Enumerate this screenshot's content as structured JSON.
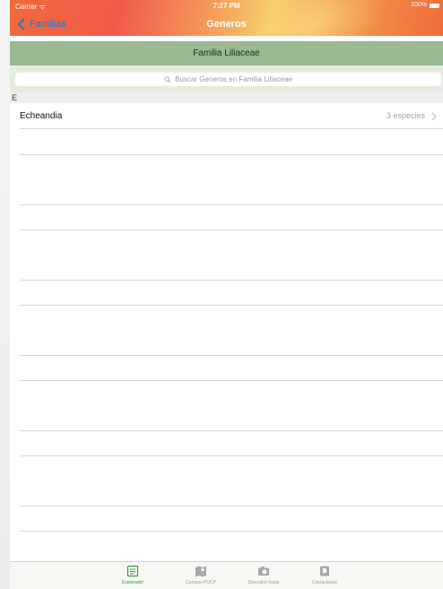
{
  "status": {
    "carrier": "Carrier ᯤ",
    "time": "7:27 PM",
    "battery": "100%"
  },
  "nav": {
    "back_label": "Familias",
    "title": "Generos"
  },
  "family_header": "Familia Liliaceae",
  "search": {
    "placeholder": "Buscar Generos en Familia Liliaceae"
  },
  "section": {
    "letter": "E"
  },
  "rows": [
    {
      "title": "Echeandia",
      "detail": "3 especies"
    }
  ],
  "tabs": [
    {
      "label": "Explorador",
      "icon": "explorer-icon",
      "active": true
    },
    {
      "label": "Campus PUCP",
      "icon": "map-icon",
      "active": false
    },
    {
      "label": "Descubre hojas",
      "icon": "camera-icon",
      "active": false
    },
    {
      "label": "Contactanos",
      "icon": "contact-icon",
      "active": false
    }
  ],
  "colors": {
    "accent": "#1a7bd6",
    "header_green": "#9ab892",
    "tab_active": "#3a9a3a"
  }
}
